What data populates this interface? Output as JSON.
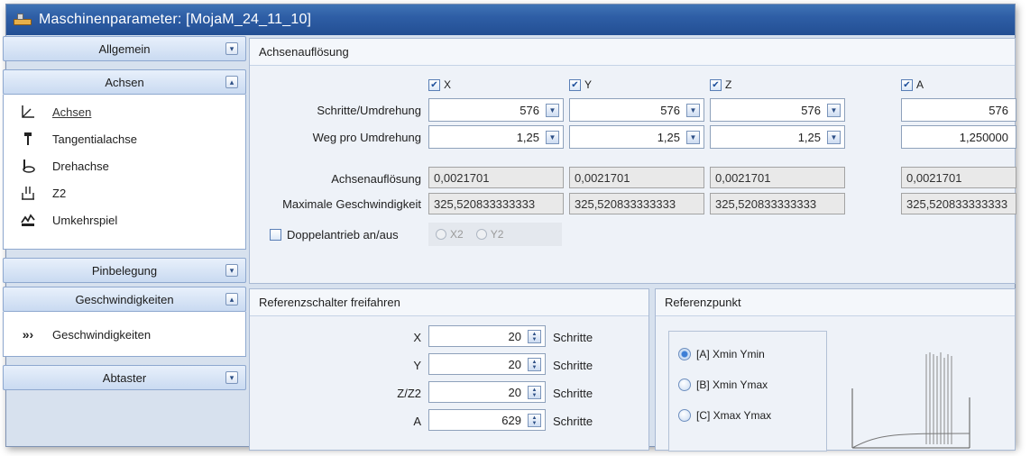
{
  "window": {
    "title": "Maschinenparameter: [MojaM_24_11_10]"
  },
  "sidebar": {
    "groups": [
      {
        "label": "Allgemein",
        "expanded": false,
        "chevron": "▾"
      },
      {
        "label": "Achsen",
        "expanded": true,
        "chevron": "▴",
        "items": [
          {
            "label": "Achsen",
            "icon": "axes-icon"
          },
          {
            "label": "Tangentialachse",
            "icon": "tangential-axis-icon"
          },
          {
            "label": "Drehachse",
            "icon": "rotary-axis-icon"
          },
          {
            "label": "Z2",
            "icon": "z2-icon"
          },
          {
            "label": "Umkehrspiel",
            "icon": "backlash-icon"
          }
        ]
      },
      {
        "label": "Pinbelegung",
        "expanded": false,
        "chevron": "▾"
      },
      {
        "label": "Geschwindigkeiten",
        "expanded": true,
        "chevron": "▴",
        "items": [
          {
            "label": "Geschwindigkeiten",
            "icon": "speed-icon"
          }
        ]
      },
      {
        "label": "Abtaster",
        "expanded": false,
        "chevron": "▾"
      }
    ]
  },
  "axes_panel": {
    "title": "Achsenauflösung",
    "columns": [
      {
        "axis": "X",
        "checked": true,
        "steps": "576",
        "travel": "1,25",
        "resolution": "0,0021701",
        "max_speed": "325,520833333333"
      },
      {
        "axis": "Y",
        "checked": true,
        "steps": "576",
        "travel": "1,25",
        "resolution": "0,0021701",
        "max_speed": "325,520833333333"
      },
      {
        "axis": "Z",
        "checked": true,
        "steps": "576",
        "travel": "1,25",
        "resolution": "0,0021701",
        "max_speed": "325,520833333333"
      },
      {
        "axis": "A",
        "checked": true,
        "steps": "576",
        "travel": "1,250000",
        "resolution": "0,0021701",
        "max_speed": "325,520833333333"
      }
    ],
    "labels": {
      "steps": "Schritte/Umdrehung",
      "travel": "Weg pro Umdrehung",
      "resolution": "Achsenauflösung",
      "max_speed": "Maximale Geschwindigkeit"
    },
    "dual_drive": {
      "label": "Doppelantrieb an/aus",
      "checked": false,
      "options": [
        "X2",
        "Y2"
      ]
    }
  },
  "ref_panel": {
    "title": "Referenzschalter freifahren",
    "rows": [
      {
        "label": "X",
        "value": "20",
        "unit": "Schritte"
      },
      {
        "label": "Y",
        "value": "20",
        "unit": "Schritte"
      },
      {
        "label": "Z/Z2",
        "value": "20",
        "unit": "Schritte"
      },
      {
        "label": "A",
        "value": "629",
        "unit": "Schritte"
      }
    ]
  },
  "refpoint_panel": {
    "title": "Referenzpunkt",
    "options": [
      {
        "label": "[A]  Xmin Ymin",
        "selected": true
      },
      {
        "label": "[B] Xmin Ymax",
        "selected": false
      },
      {
        "label": "[C] Xmax Ymax",
        "selected": false
      }
    ]
  }
}
